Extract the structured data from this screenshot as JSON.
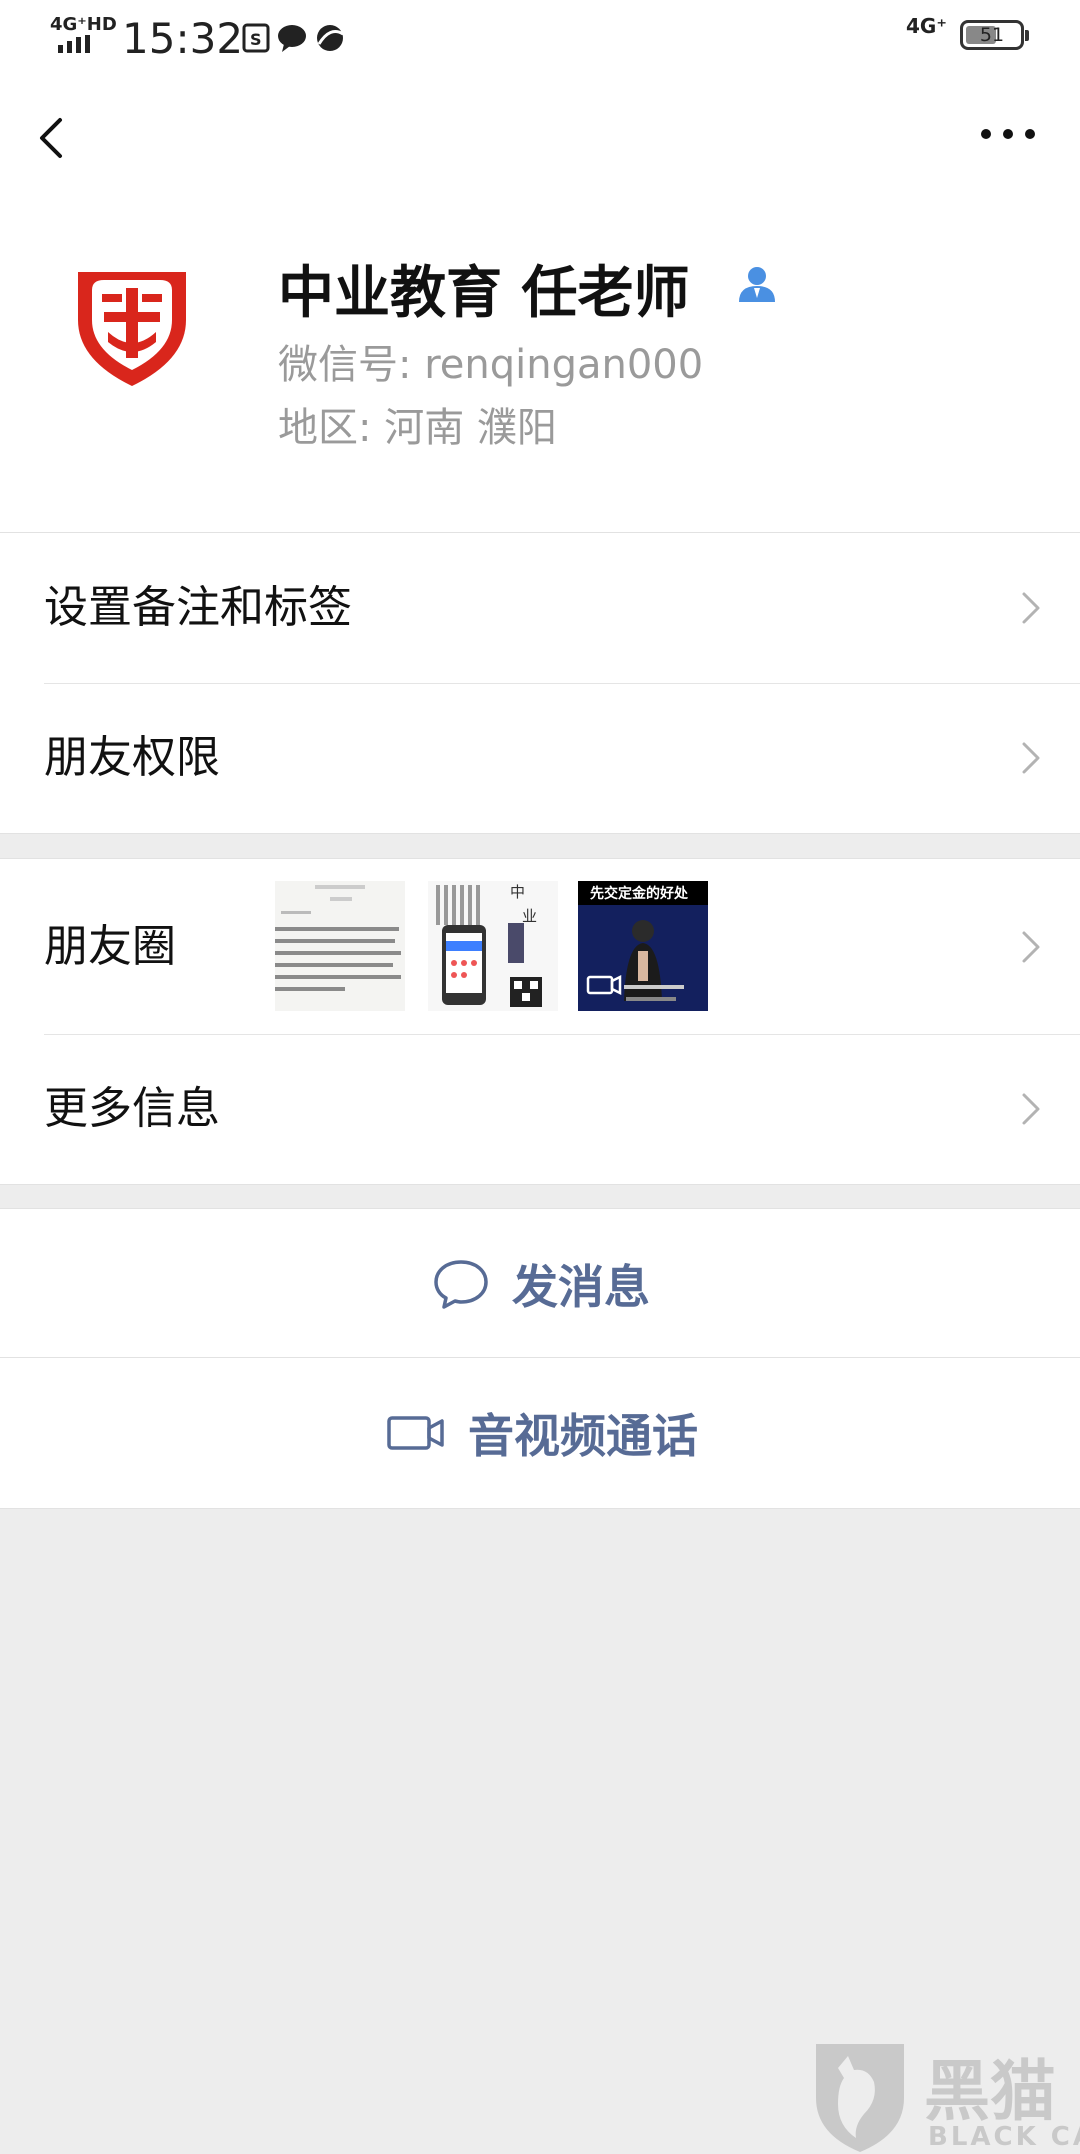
{
  "status_bar": {
    "network_left": "4G⁺HD",
    "time": "15:32",
    "network_right": "4G⁺",
    "battery": "51",
    "icons": [
      "sim-icon",
      "chat-bubble-icon",
      "browser-icon"
    ]
  },
  "profile": {
    "name": "中业教育  任老师",
    "wechat_id": "微信号: renqingan000",
    "region": "地区: 河南  濮阳",
    "verified_icon": "person-badge-icon"
  },
  "menu": {
    "set_remark": "设置备注和标签",
    "friend_permissions": "朋友权限",
    "moments": "朋友圈",
    "more_info": "更多信息"
  },
  "moments_thumbnails": [
    {
      "type": "text-image"
    },
    {
      "type": "phone-ad",
      "caption": "中业网校"
    },
    {
      "type": "video",
      "caption": "先交定金的好处"
    }
  ],
  "actions": {
    "send_message": "发消息",
    "video_call": "音视频通话"
  },
  "watermark": {
    "text": "黑猫",
    "sub": "BLACK CAT"
  },
  "colors": {
    "link": "#576b95",
    "logo_red": "#d9261c",
    "verified_blue": "#4a90e2"
  }
}
